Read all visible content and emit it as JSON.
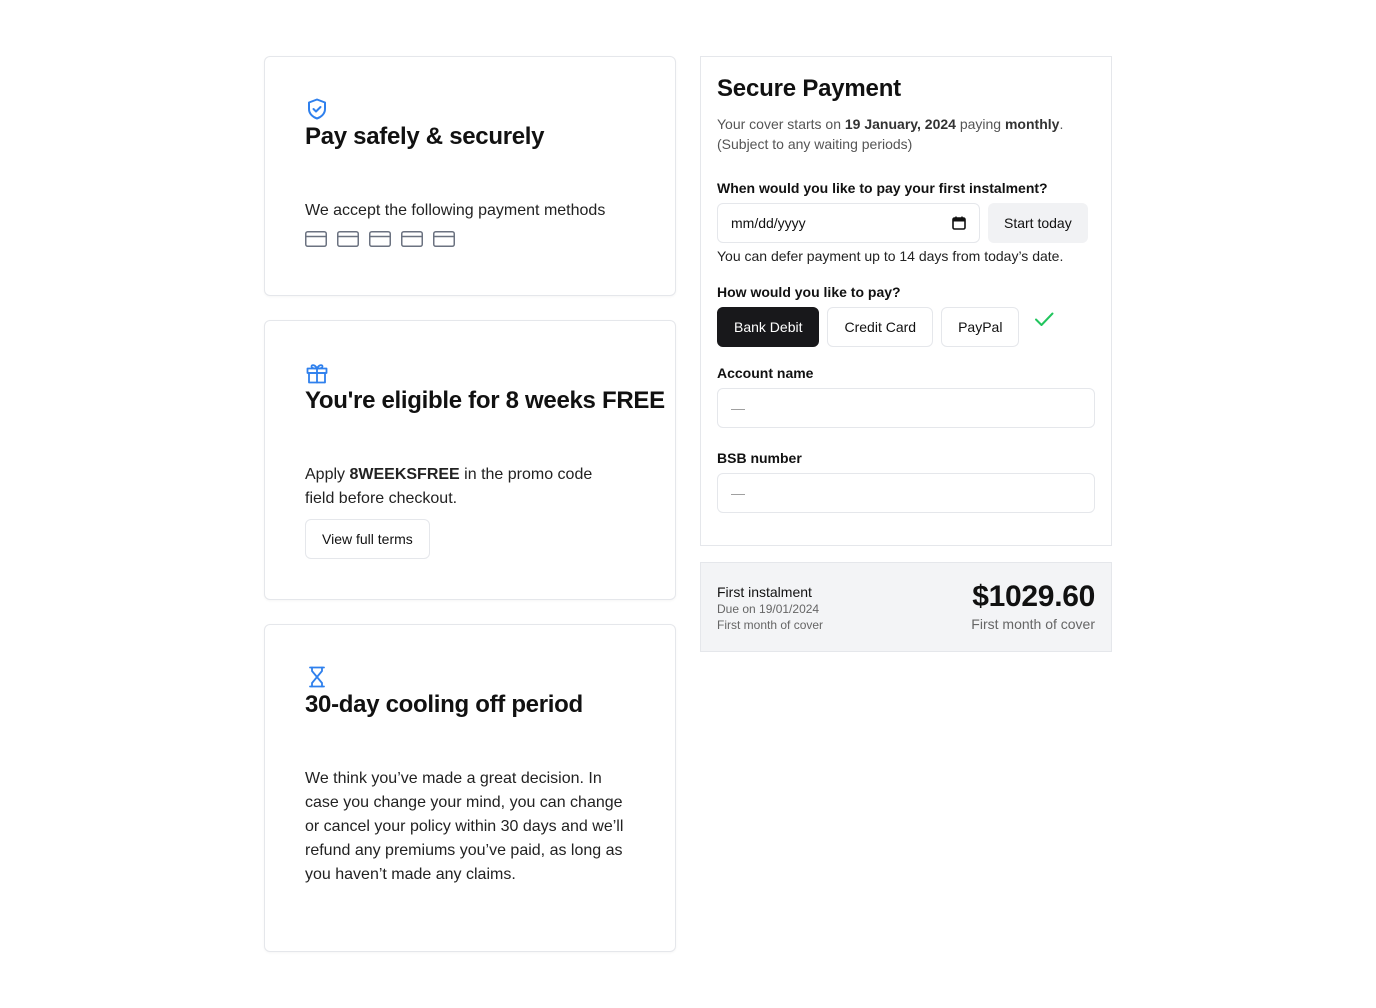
{
  "cards": {
    "pay": {
      "title": "Pay safely & securely",
      "body": "We accept the following payment methods",
      "icon": "shield-check-icon"
    },
    "promo": {
      "title": "You're eligible for 8 weeks FREE",
      "body_prefix": "Apply ",
      "promo_code": "8WEEKSFREE",
      "body_suffix": " in the promo code field before checkout.",
      "button_label": "View full terms",
      "icon": "gift-icon"
    },
    "cooling": {
      "title": "30-day cooling off period",
      "body": "We think you’ve made a great decision. In case you change your mind, you can change or cancel your policy within 30 days and we’ll refund any premiums you’ve paid, as long as you haven’t made any claims.",
      "icon": "hourglass-icon"
    }
  },
  "payment": {
    "title": "Secure Payment",
    "cover_prefix": "Your cover starts on ",
    "cover_date": "19 January, 2024",
    "cover_middle": " paying ",
    "cover_frequency": "monthly",
    "cover_suffix": ".",
    "cover_note": "(Subject to any waiting periods)",
    "first_instalment_question": "When would you like to pay your first instalment?",
    "date_placeholder": "mm/dd/yyyy",
    "start_today_label": "Start today",
    "defer_text": "You can defer payment up to 14 days from today’s date.",
    "method_question": "How would you like to pay?",
    "methods": [
      "Bank Debit",
      "Credit Card",
      "PayPal"
    ],
    "selected_method": "Bank Debit",
    "account_name_label": "Account name",
    "account_name_value": "—",
    "bsb_label": "BSB number",
    "bsb_value": "—"
  },
  "summary": {
    "title": "First instalment",
    "due": "Due on 19/01/2024",
    "note": "First month of cover",
    "amount": "$1029.60",
    "amount_note": "First month of cover"
  },
  "colors": {
    "accent": "#2f80ed",
    "success": "#22c55e",
    "dark_button": "#18181b"
  }
}
